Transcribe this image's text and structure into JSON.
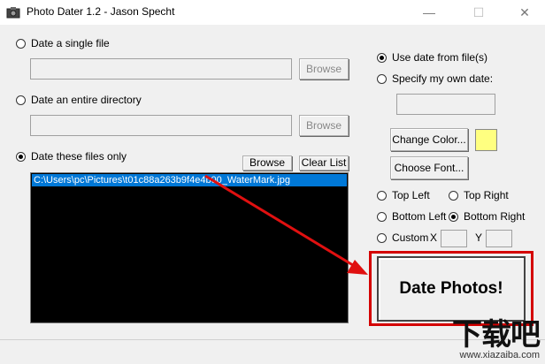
{
  "window": {
    "title": "Photo Dater 1.2 - Jason Specht"
  },
  "source": {
    "single_file_label": "Date a single file",
    "single_file_value": "",
    "single_browse": "Browse",
    "directory_label": "Date an entire directory",
    "directory_value": "",
    "dir_browse": "Browse",
    "files_only_label": "Date these files only",
    "files_browse": "Browse",
    "clear_list": "Clear List",
    "files": [
      "C:\\Users\\pc\\Pictures\\t01c88a263b9f4e4b00_WaterMark.jpg"
    ]
  },
  "date_options": {
    "use_file_date": "Use date from file(s)",
    "own_date": "Specify my own date:",
    "own_date_value": ""
  },
  "style": {
    "change_color": "Change Color...",
    "swatch_color": "#ffff80",
    "choose_font": "Choose Font..."
  },
  "position": {
    "top_left": "Top Left",
    "top_right": "Top Right",
    "bottom_left": "Bottom Left",
    "bottom_right": "Bottom Right",
    "custom": "Custom",
    "x_label": "X",
    "y_label": "Y",
    "x_value": "",
    "y_value": ""
  },
  "action": {
    "date_photos": "Date Photos!"
  },
  "watermark": {
    "main": "下载吧",
    "url": "www.xiazaiba.com"
  }
}
